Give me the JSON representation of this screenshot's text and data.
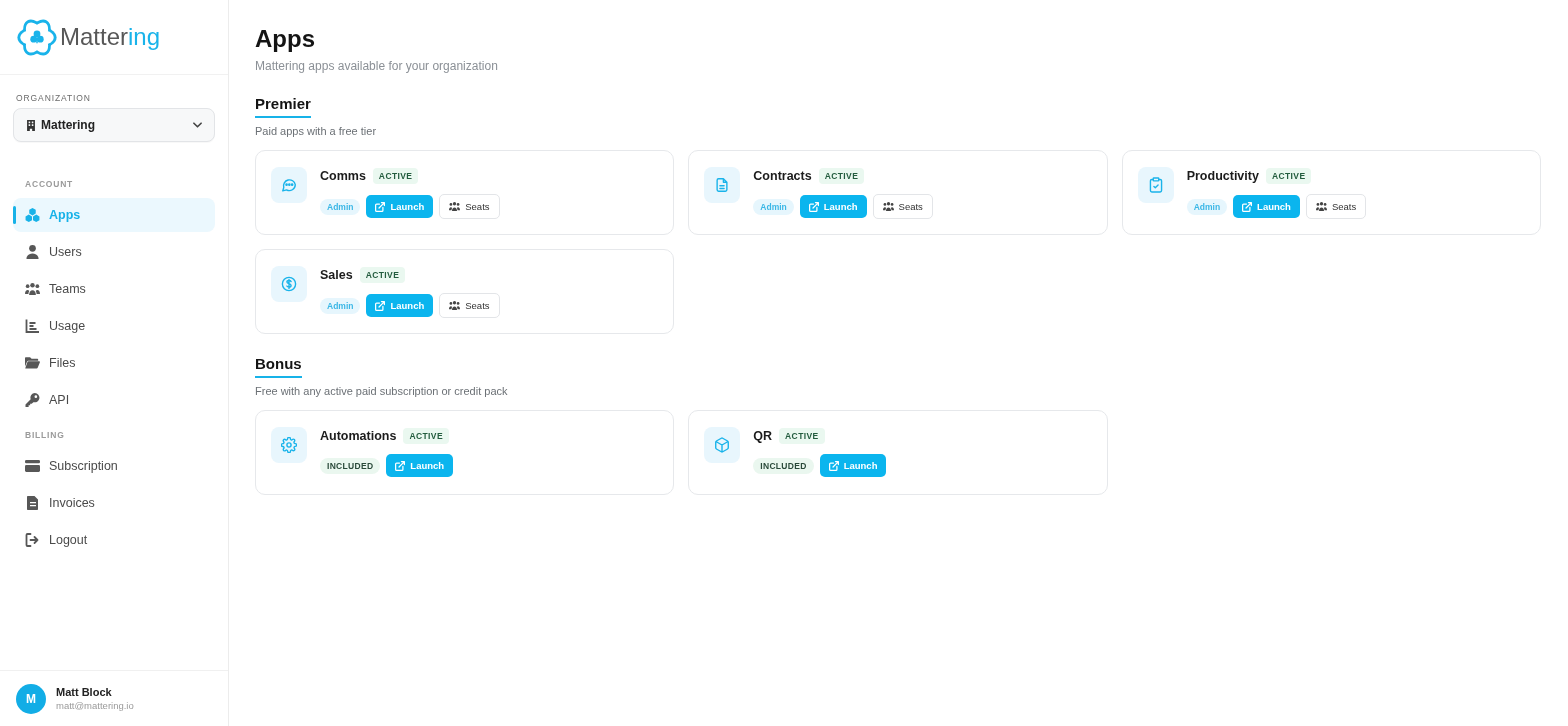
{
  "sidebar": {
    "logo": {
      "text": "Matter",
      "accent": "ing"
    },
    "organization": {
      "label": "ORGANIZATION",
      "value": "Mattering"
    },
    "sections": [
      {
        "heading": "ACCOUNT",
        "items": [
          {
            "label": "Apps",
            "selected": true
          },
          {
            "label": "Users",
            "selected": false
          },
          {
            "label": "Teams",
            "selected": false
          },
          {
            "label": "Usage",
            "selected": false
          },
          {
            "label": "Files",
            "selected": false
          },
          {
            "label": "API",
            "selected": false
          }
        ]
      },
      {
        "heading": "BILLING",
        "items": [
          {
            "label": "Subscription",
            "selected": false
          },
          {
            "label": "Invoices",
            "selected": false
          },
          {
            "label": "Logout",
            "selected": false
          }
        ]
      }
    ],
    "user": {
      "initial": "M",
      "name": "Matt Block",
      "email": "matt@mattering.io"
    }
  },
  "main": {
    "title": "Apps",
    "subtitle": "Mattering apps available for your organization",
    "sections": [
      {
        "title": "Premier",
        "description": "Paid apps with a free tier",
        "apps": [
          {
            "name": "Comms",
            "status": "ACTIVE",
            "access": {
              "kind": "role",
              "label": "Admin"
            },
            "actions": [
              {
                "kind": "launch",
                "label": "Launch"
              },
              {
                "kind": "seats",
                "label": "Seats"
              }
            ]
          },
          {
            "name": "Contracts",
            "status": "ACTIVE",
            "access": {
              "kind": "role",
              "label": "Admin"
            },
            "actions": [
              {
                "kind": "launch",
                "label": "Launch"
              },
              {
                "kind": "seats",
                "label": "Seats"
              }
            ]
          },
          {
            "name": "Productivity",
            "status": "ACTIVE",
            "access": {
              "kind": "role",
              "label": "Admin"
            },
            "actions": [
              {
                "kind": "launch",
                "label": "Launch"
              },
              {
                "kind": "seats",
                "label": "Seats"
              }
            ]
          },
          {
            "name": "Sales",
            "status": "ACTIVE",
            "access": {
              "kind": "role",
              "label": "Admin"
            },
            "actions": [
              {
                "kind": "launch",
                "label": "Launch"
              },
              {
                "kind": "seats",
                "label": "Seats"
              }
            ]
          }
        ]
      },
      {
        "title": "Bonus",
        "description": "Free with any active paid subscription or credit pack",
        "apps": [
          {
            "name": "Automations",
            "status": "ACTIVE",
            "access": {
              "kind": "plan",
              "label": "INCLUDED"
            },
            "actions": [
              {
                "kind": "launch",
                "label": "Launch"
              }
            ]
          },
          {
            "name": "QR",
            "status": "ACTIVE",
            "access": {
              "kind": "plan",
              "label": "INCLUDED"
            },
            "actions": [
              {
                "kind": "launch",
                "label": "Launch"
              }
            ]
          }
        ]
      }
    ]
  }
}
